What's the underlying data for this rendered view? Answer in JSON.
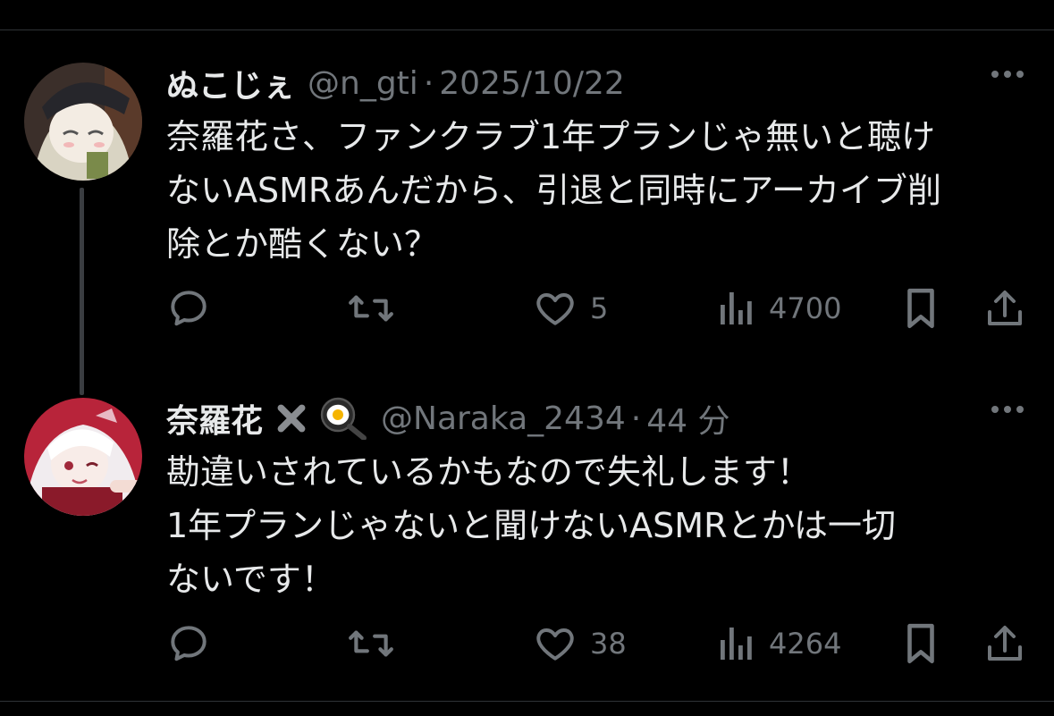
{
  "tweets": [
    {
      "display_name": "ぬこじぇ",
      "handle": "@n_gti",
      "separator": "·",
      "time": "2025/10/22",
      "text_lines": [
        "奈羅花さ、ファンクラブ1年プランじゃ無いと聴け",
        "ないASMRあんだから、引退と同時にアーカイブ削",
        "除とか酷くない？"
      ],
      "reply_count": "",
      "retweet_count": "",
      "like_count": "5",
      "view_count": "4700",
      "avatar_colors": {
        "bg": "#3b2f2a",
        "hair": "#d9d4c3",
        "hat": "#26262b"
      }
    },
    {
      "display_name": "奈羅花",
      "badges": [
        "cross-mark-icon",
        "frying-pan-egg-icon"
      ],
      "handle": "@Naraka_2434",
      "separator": "·",
      "time": "44 分",
      "text_lines": [
        "勘違いされているかもなので失礼します！",
        "1年プランじゃないと聞けないASMRとかは一切",
        "ないです！"
      ],
      "reply_count": "",
      "retweet_count": "",
      "like_count": "38",
      "view_count": "4264",
      "avatar_colors": {
        "bg": "#b8243a",
        "hair": "#f1ecef",
        "accent": "#e8b9c4"
      }
    }
  ],
  "theme": {
    "background": "#000000",
    "text": "#e7e9ea",
    "muted": "#71767b",
    "divider": "#2f3336"
  }
}
